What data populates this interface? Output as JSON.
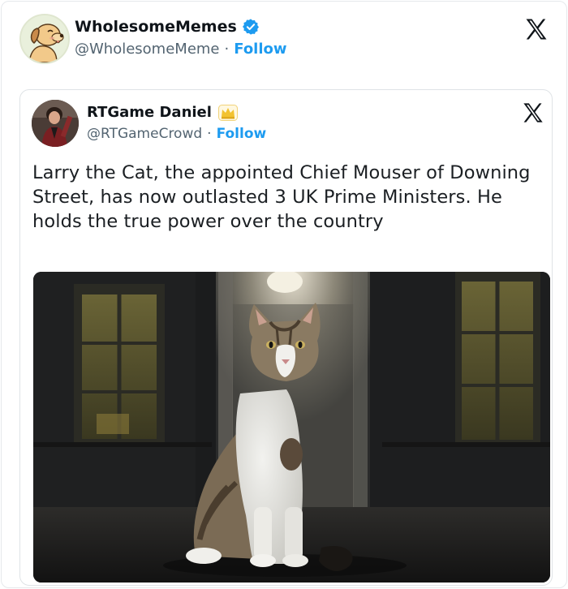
{
  "outer_tweet": {
    "display_name": "WholesomeMemes",
    "handle": "@WholesomeMeme",
    "separator": "·",
    "follow_label": "Follow"
  },
  "quoted_tweet": {
    "display_name": "RTGame Daniel",
    "handle": "@RTGameCrowd",
    "separator": "·",
    "follow_label": "Follow",
    "text": "Larry the Cat, the appointed Chief Mouser of Downing Street, has now outlasted 3 UK Prime Ministers. He holds the true power over the country"
  },
  "icons": {
    "verified": "verified-badge-icon",
    "x_logo": "x-logo-icon",
    "crown_badge": "crown-badge-icon"
  },
  "colors": {
    "accent": "#1d9bf0",
    "text_primary": "#0f1419",
    "text_secondary": "#536471",
    "border": "#e6e9ec"
  }
}
